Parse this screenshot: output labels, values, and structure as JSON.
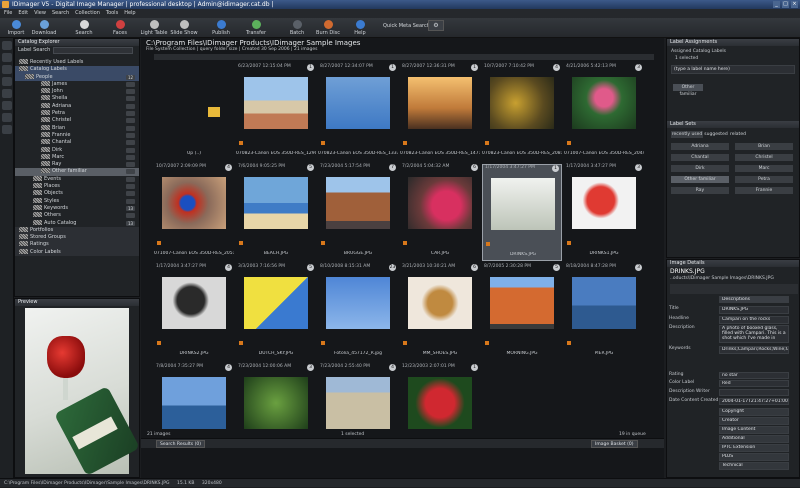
{
  "window": {
    "title": "IDimager V5 - Digital Image Manager | professional desktop | Admin@idimager.cat.db |"
  },
  "menu": [
    "File",
    "Edit",
    "View",
    "Search",
    "Collection",
    "Tools",
    "Help"
  ],
  "toolbar": [
    {
      "label": "Import",
      "icon": "import-icon",
      "color": "#4a8ad8"
    },
    {
      "label": "Download",
      "icon": "download-icon",
      "color": "#6aa0d8"
    },
    {
      "label": "Search",
      "icon": "search-icon",
      "color": "#d8d8d8"
    },
    {
      "label": "Faces",
      "icon": "faces-icon",
      "color": "#d04040"
    },
    {
      "label": "Light Table",
      "icon": "light-table-icon",
      "color": "#bfbfbf"
    },
    {
      "label": "Slide Show",
      "icon": "slideshow-icon",
      "color": "#bfbfbf"
    },
    {
      "label": "Publish",
      "icon": "publish-icon",
      "color": "#3b7bd0"
    },
    {
      "label": "Transfer",
      "icon": "transfer-icon",
      "color": "#5cb05c"
    },
    {
      "label": "Batch",
      "icon": "batch-icon",
      "color": "#5a6068"
    },
    {
      "label": "Burn Disc",
      "icon": "burn-disc-icon",
      "color": "#d06a30"
    },
    {
      "label": "Help",
      "icon": "help-icon",
      "color": "#3b7bd0"
    }
  ],
  "quick_search": "Quick Meta Search",
  "catalog": {
    "title": "Catalog Explorer",
    "label_search": "Label Search",
    "items": [
      {
        "label": "Recently Used Labels"
      },
      {
        "label": "Catalog Labels"
      },
      {
        "label": "People",
        "count": "12"
      },
      {
        "label": "James"
      },
      {
        "label": "John"
      },
      {
        "label": "Sheila"
      },
      {
        "label": "Adriana"
      },
      {
        "label": "Petra"
      },
      {
        "label": "Christel"
      },
      {
        "label": "Brian"
      },
      {
        "label": "Frannie"
      },
      {
        "label": "Chantal"
      },
      {
        "label": "Dirk"
      },
      {
        "label": "Marc"
      },
      {
        "label": "Ray"
      },
      {
        "label": "Other familiar"
      },
      {
        "label": "Events"
      },
      {
        "label": "Places"
      },
      {
        "label": "Objects"
      },
      {
        "label": "Styles"
      },
      {
        "label": "Keywords",
        "count": "13"
      },
      {
        "label": "Others"
      },
      {
        "label": "Auto Catalog",
        "count": "13"
      },
      {
        "label": "Portfolios"
      },
      {
        "label": "Stored Groups"
      },
      {
        "label": "Ratings"
      },
      {
        "label": "Color Labels"
      }
    ]
  },
  "preview": {
    "title": "Preview"
  },
  "browser": {
    "path": "C:\\Program Files\\IDimager Products\\IDimager Sample Images",
    "subtitle": "File System Collection | query folder size | Created 30 Sep 2006 | 21 images",
    "status_left": "21 images",
    "status_mid": "1 selected",
    "status_right": "19 in queue",
    "search_results": "Search Results (0)",
    "image_basket": "Image Basket (0)",
    "cells": [
      {
        "date": "",
        "badge": "",
        "name": "Up (..)",
        "kind": "folder"
      },
      {
        "date": "6/23/2007 12:15:04 PM",
        "badge": "1",
        "name": "070823-Canon EOS 350D-RES_1290.JPG",
        "kind": "buildings"
      },
      {
        "date": "8/27/2007 12:34:07 PM",
        "badge": "1",
        "name": "070823-Canon EOS 350D-RES_1333.JPG",
        "kind": "palm"
      },
      {
        "date": "8/27/2007 12:36:31 PM",
        "badge": "1",
        "name": "070823-Canon EOS 350D-RES_1471.JPG",
        "kind": "sunset"
      },
      {
        "date": "10/7/2007 7:10:42 PM",
        "badge": "4",
        "name": "070823-Canon EOS 350D-RES_2081.JPG",
        "kind": "leaves"
      },
      {
        "date": "4/21/2006 5:42:13 PM",
        "badge": "3",
        "name": "071007-Canon EOS 350D-RES_2044.JPG",
        "kind": "lotus"
      },
      {
        "date": "10/7/2007 2:09:09 PM",
        "badge": "4",
        "name": "071007-Canon EOS 350D-RES_2051.JPG",
        "kind": "bird"
      },
      {
        "date": "7/6/2004 9:05:25 PM",
        "badge": "5",
        "name": "BEACH.JPG",
        "kind": "beach"
      },
      {
        "date": "7/23/2004 5:17:54 PM",
        "badge": "7",
        "name": "BRUGGE.JPG",
        "kind": "brugge"
      },
      {
        "date": "7/2/2004 5:04:32 AM",
        "badge": "6",
        "name": "CAR.JPG",
        "kind": "car"
      },
      {
        "date": "1/17/2004 3:47:27 PM",
        "badge": "1",
        "name": "DRINKS.JPG",
        "kind": "drinks",
        "selected": true
      },
      {
        "date": "1/17/2004 3:47:27 PM",
        "badge": "3",
        "name": "DRINKS1.JPG",
        "kind": "glass"
      },
      {
        "date": "1/17/2004 3:47:27 PM",
        "badge": "4",
        "name": "DRINKS2.JPG",
        "kind": "glassbw"
      },
      {
        "date": "3/3/2003 7:16:56 PM",
        "badge": "5",
        "name": "DUTCH_SKY.JPG",
        "kind": "dutchsky"
      },
      {
        "date": "8/10/2008 8:15:31 AM",
        "badge": "23",
        "name": "Fotolia_457172_R.jpg",
        "kind": "wind"
      },
      {
        "date": "3/21/2003 10:30:21 AM",
        "badge": "6",
        "name": "MM_SHOES.JPG",
        "kind": "shoes"
      },
      {
        "date": "8/7/2005 2:30:28 PM",
        "badge": "5",
        "name": "MORNING.JPG",
        "kind": "morning"
      },
      {
        "date": "8/18/2004 8:47:28 PM",
        "badge": "3",
        "name": "PIER.JPG",
        "kind": "pier"
      },
      {
        "date": "7/8/2004 7:35:27 PM",
        "badge": "4",
        "name": "",
        "kind": "sea"
      },
      {
        "date": "7/23/2004 12:00:06 AM",
        "badge": "3",
        "name": "",
        "kind": "green"
      },
      {
        "date": "7/23/2004 2:55:40 PM",
        "badge": "4",
        "name": "",
        "kind": "church"
      },
      {
        "date": "12/23/2003 2:07:01 PM",
        "badge": "1",
        "name": "",
        "kind": "flower"
      }
    ]
  },
  "labels": {
    "title": "Label Assignments",
    "assigned": "Assigned Catalog Labels",
    "assigned_count": "1 selected",
    "type_hint": "(type a label name here)",
    "assigned_item": "Other familiar",
    "sets_title": "Label Sets",
    "tabs": [
      "recently used",
      "suggested",
      "related"
    ],
    "set_items": [
      "Adriana",
      "Brian",
      "Chantal",
      "Christel",
      "Dirk",
      "Marc",
      "Other familiar",
      "Petra",
      "Ray",
      "Frannie"
    ]
  },
  "details": {
    "title": "Image Details",
    "file": "DRINKS.JPG",
    "path": "..oducts\\IDimager Sample Images\\DRINKS.JPG",
    "section": "Descriptions",
    "fields": [
      {
        "label": "Title",
        "value": "DRINKS.JPG"
      },
      {
        "label": "Headline",
        "value": "Campari on the rocks"
      },
      {
        "label": "Description",
        "value": "A photo of booxed glass, filled with Campari. This is a shot which I've made in"
      },
      {
        "label": "Keywords",
        "value": "Drinks;Campari;Rocks;Wine;Gl..."
      },
      {
        "label": "Rating",
        "value": "no star"
      },
      {
        "label": "Color Label",
        "value": "Red"
      },
      {
        "label": "Description Writer",
        "value": ""
      },
      {
        "label": "Date Content Created",
        "value": "2004-01-17T21:47:27+01:00"
      }
    ],
    "sections": [
      "Copyright",
      "Creator",
      "Image Content",
      "Additional",
      "IPTC Extension",
      "PLUS",
      "Technical"
    ]
  },
  "statusbar": {
    "path": "C:\\Program Files\\IDimager Products\\IDimager\\Sample Images\\DRINKS.JPG",
    "size": "15.1 KB",
    "dims": "320x480"
  }
}
